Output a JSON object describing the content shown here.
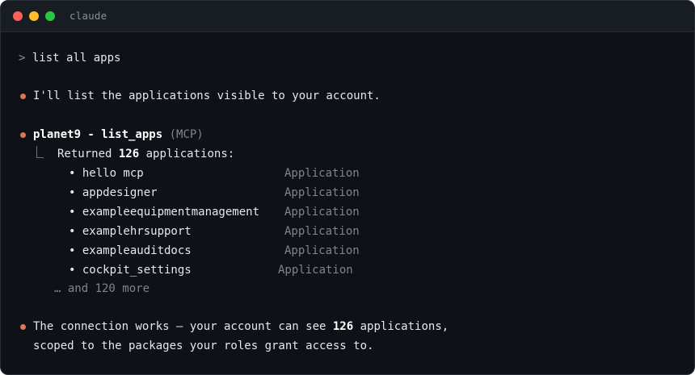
{
  "window": {
    "title": "claude"
  },
  "prompt": {
    "caret": ">",
    "command": "list all apps"
  },
  "messages": {
    "intro": "I'll list the applications visible to your account.",
    "tool_name": "planet9 - list_apps",
    "tool_tag": "(MCP)",
    "returned_prefix": "Returned",
    "returned_count": "126",
    "returned_suffix": "applications:",
    "more": "… and 120 more",
    "summary_line1_prefix": "The connection works — your account can see",
    "summary_count": "126",
    "summary_line1_suffix": "applications,",
    "summary_line2": "scoped to the packages your roles grant access to."
  },
  "apps": [
    {
      "name": "hello mcp",
      "type": "Application"
    },
    {
      "name": "appdesigner",
      "type": "Application"
    },
    {
      "name": "exampleequipmentmanagement",
      "type": "Application"
    },
    {
      "name": "examplehrsupport",
      "type": "Application"
    },
    {
      "name": "exampleauditdocs",
      "type": "Application"
    },
    {
      "name": "cockpit_settings",
      "type": "Application"
    }
  ],
  "colors": {
    "bullet": "#d97757",
    "background": "#0e1117",
    "text": "#e6e8eb",
    "muted": "#7d8590"
  }
}
